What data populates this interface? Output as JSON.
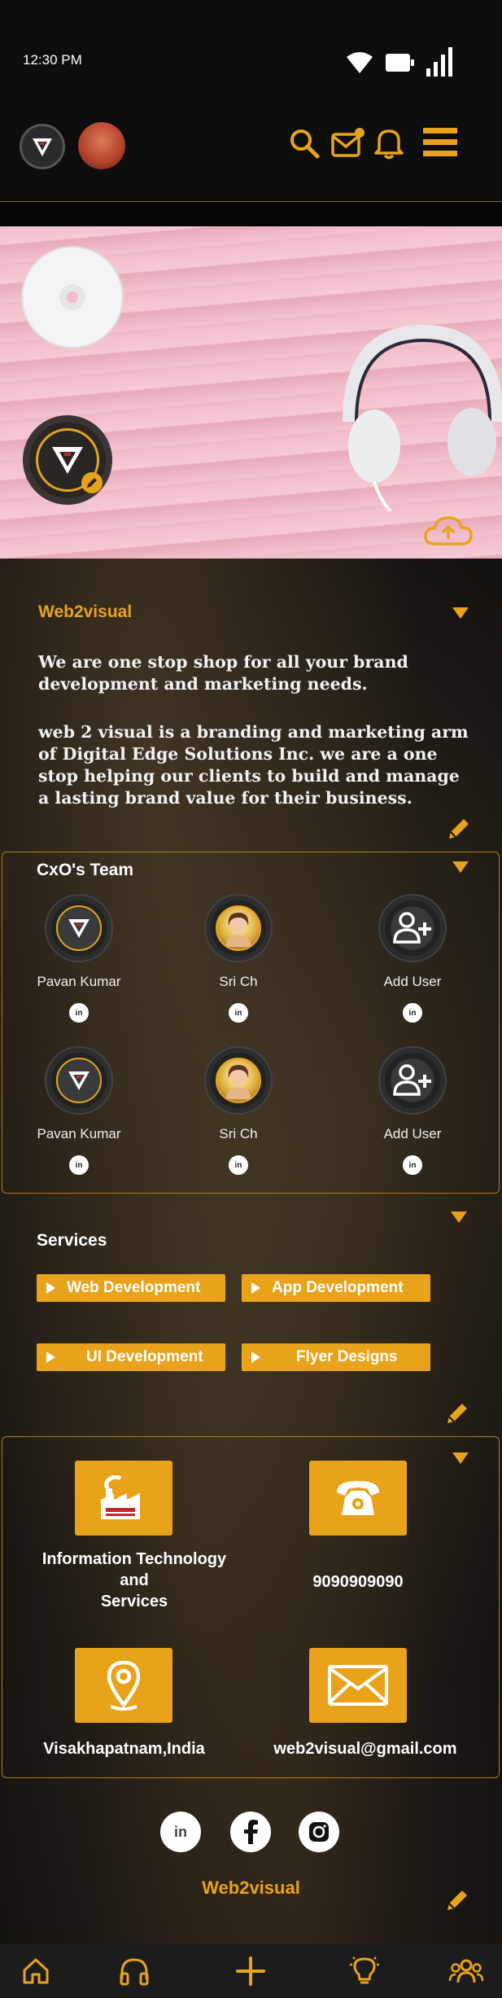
{
  "status_bar": {
    "time": "12:30 PM"
  },
  "header": {
    "icons": [
      "logo-icon",
      "profile-avatar",
      "search-icon",
      "mail-icon",
      "bell-icon",
      "menu-icon"
    ]
  },
  "about": {
    "title": "Web2visual",
    "paragraph1": "We are one stop shop for all your brand development and marketing needs.",
    "paragraph2": "web 2 visual is a branding and marketing arm of Digital Edge Solutions Inc. we are a one stop helping our clients to build and manage a lasting brand value for their business."
  },
  "team": {
    "title": "CxO's Team",
    "members": [
      {
        "name": "Pavan Kumar",
        "badge": "in"
      },
      {
        "name": "Sri Ch",
        "badge": "in"
      },
      {
        "name": "Add User",
        "badge": "in"
      },
      {
        "name": "Pavan Kumar",
        "badge": "in"
      },
      {
        "name": "Sri Ch",
        "badge": "in"
      },
      {
        "name": "Add User",
        "badge": "in"
      }
    ]
  },
  "services": {
    "title": "Services",
    "items": [
      "Web Development",
      "App Development",
      "UI Development",
      "Flyer Designs"
    ]
  },
  "contact": {
    "industry": "Information Technology and Services",
    "industry_line1": "Information Technology",
    "industry_line2": "and",
    "industry_line3": "Services",
    "phone": "9090909090",
    "location": "Visakhapatnam,India",
    "email": "web2visual@gmail.com"
  },
  "footer": {
    "brand": "Web2visual",
    "social": [
      "linkedin-icon",
      "facebook-icon",
      "instagram-icon"
    ],
    "in_label": "in"
  },
  "bottom_nav": [
    "home-icon",
    "headphones-icon",
    "plus-icon",
    "lightbulb-icon",
    "people-icon"
  ],
  "colors": {
    "accent": "#e9a31b",
    "background": "#141210",
    "nav": "#1c1c1c"
  }
}
